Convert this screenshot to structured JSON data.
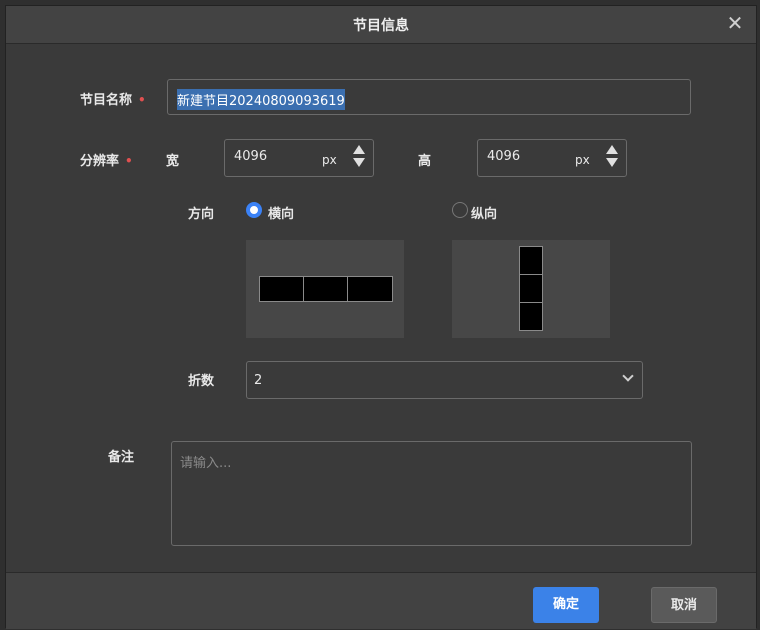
{
  "dialog": {
    "title": "节目信息",
    "close_icon": "close-icon"
  },
  "form": {
    "name": {
      "label": "节目名称",
      "required_mark": "•",
      "value": "新建节目20240809093619"
    },
    "resolution": {
      "label": "分辨率",
      "required_mark": "•",
      "width_label": "宽",
      "width_value": "4096",
      "height_label": "高",
      "height_value": "4096",
      "unit": "px"
    },
    "orientation": {
      "label": "方向",
      "options": [
        {
          "label": "横向",
          "selected": true
        },
        {
          "label": "纵向",
          "selected": false
        }
      ]
    },
    "folds": {
      "label": "折数",
      "value": "2"
    },
    "notes": {
      "label": "备注",
      "placeholder": "请输入..."
    }
  },
  "footer": {
    "ok_label": "确定",
    "cancel_label": "取消"
  },
  "colors": {
    "accent": "#3b82e8",
    "required": "#e05050",
    "selection": "#3b6fb0"
  }
}
